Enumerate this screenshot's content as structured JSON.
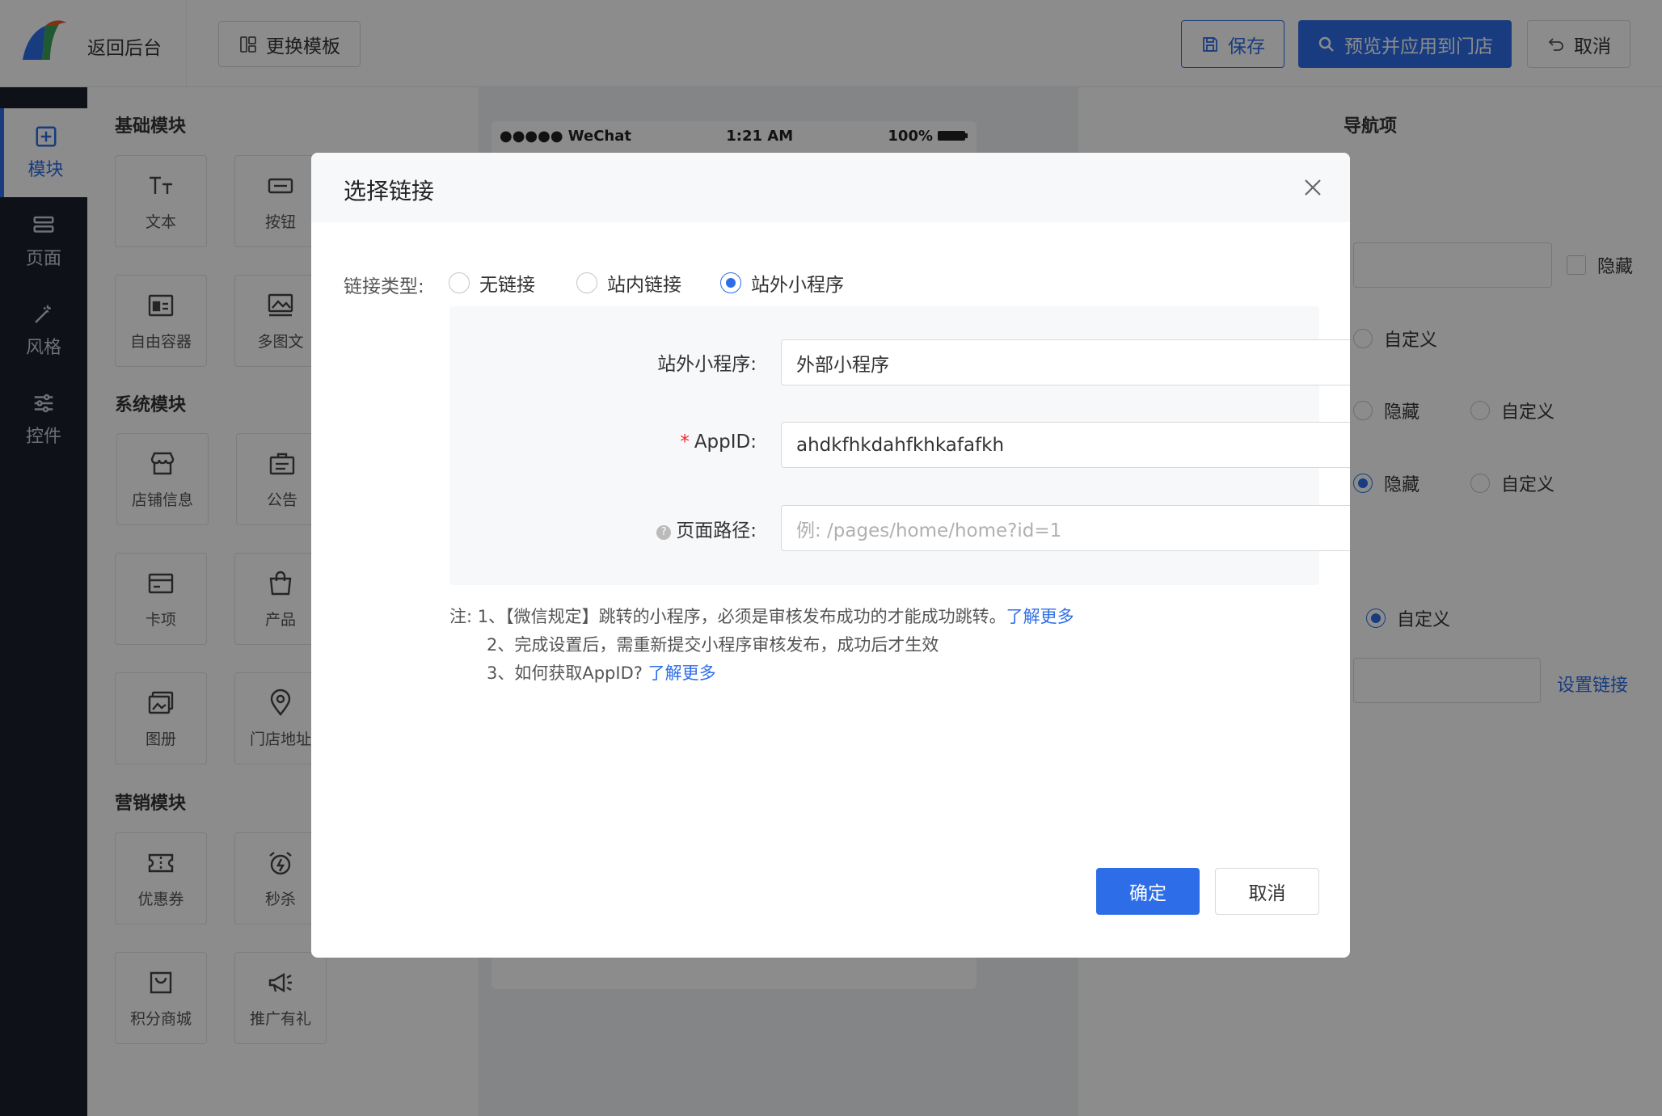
{
  "topbar": {
    "back_label": "返回后台",
    "template_label": "更换模板",
    "save_label": "保存",
    "preview_label": "预览并应用到门店",
    "cancel_label": "取消"
  },
  "leftnav": {
    "items": [
      {
        "label": "模块",
        "icon": "plus-square-icon"
      },
      {
        "label": "页面",
        "icon": "layers-icon"
      },
      {
        "label": "风格",
        "icon": "magic-wand-icon"
      },
      {
        "label": "控件",
        "icon": "sliders-icon"
      }
    ]
  },
  "modules": {
    "basic_title": "基础模块",
    "basic": [
      "文本",
      "按钮",
      "自由容器",
      "多图文"
    ],
    "system_title": "系统模块",
    "system": [
      "店铺信息",
      "公告",
      "卡项",
      "产品",
      "图册",
      "门店地址"
    ],
    "marketing_title": "营销模块",
    "marketing": [
      "优惠券",
      "秒杀",
      "积分商城",
      "推广有礼"
    ]
  },
  "phone": {
    "carrier": "●●●●● WeChat",
    "time": "1:21 AM",
    "battery": "100%"
  },
  "rightpanel": {
    "title": "导航项",
    "hide_label": "隐藏",
    "custom_label": "自定义",
    "set_link_label": "设置链接"
  },
  "modal": {
    "title": "选择链接",
    "link_type_label": "链接类型:",
    "link_types": [
      "无链接",
      "站内链接",
      "站外小程序"
    ],
    "selected_link_type": "站外小程序",
    "mini_program_label": "站外小程序:",
    "mini_program_value": "外部小程序",
    "appid_label": "AppID:",
    "appid_value": "ahdkfhkdahfkhkafafkh",
    "path_label": "页面路径:",
    "path_placeholder": "例: /pages/home/home?id=1",
    "note_prefix": "注:",
    "notes": [
      "1、【微信规定】跳转的小程序，必须是审核发布成功的才能成功跳转。",
      "2、完成设置后，需重新提交小程序审核发布，成功后才生效",
      "3、如何获取AppID?"
    ],
    "learn_more": "了解更多",
    "ok_label": "确定",
    "cancel_label": "取消"
  }
}
